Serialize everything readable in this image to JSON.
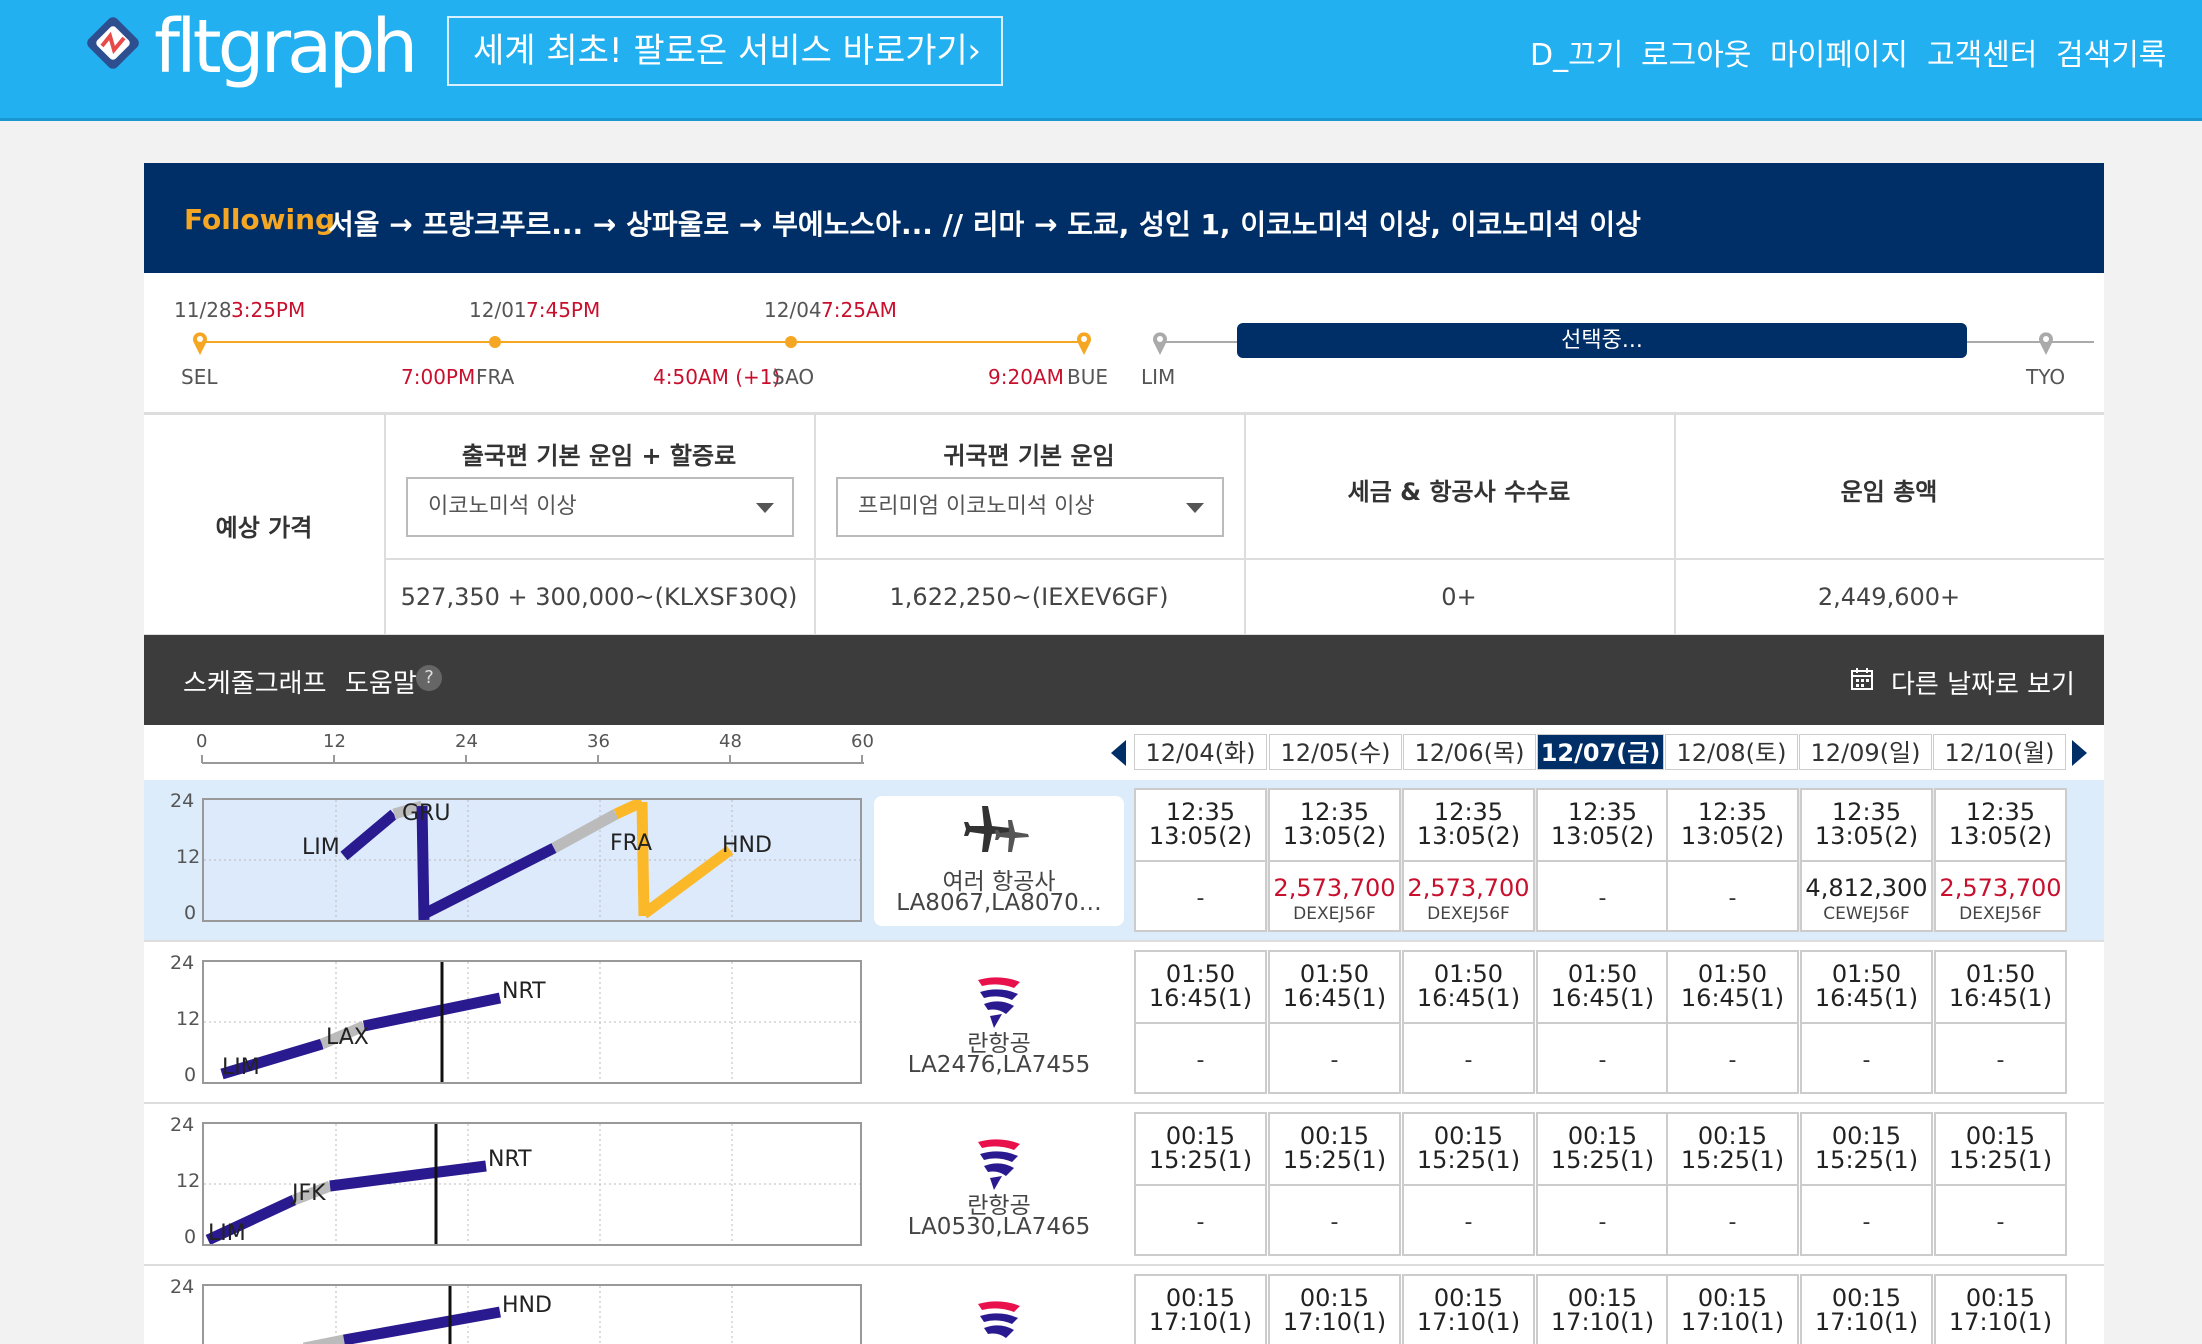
{
  "header": {
    "logo": "fltgraph",
    "promo": "세계 최초! 팔로온 서비스 바로가기",
    "nav": [
      "D_끄기",
      "로그아웃",
      "마이페이지",
      "고객센터",
      "검색기록"
    ]
  },
  "trip": {
    "following": "Following",
    "route": "서울 → 프랑크푸르... → 상파울로 → 부에노스아... // 리마 → 도쿄, 성인 1, 이코노미석 이상, 이코노미석 이상"
  },
  "timeline": {
    "points": [
      {
        "date": "11/28",
        "time": "3:25PM",
        "code": "SEL"
      },
      {
        "date": "12/01",
        "time": "7:45PM",
        "code": "FRA",
        "arrive": "7:00PM"
      },
      {
        "date": "12/04",
        "time": "7:25AM",
        "code": "SAO",
        "arrive": "4:50AM (+1)"
      },
      {
        "code": "BUE",
        "arrive": "9:20AM"
      },
      {
        "code": "LIM"
      },
      {
        "code": "TYO"
      }
    ],
    "selecting": "선택중..."
  },
  "prices": {
    "label": "예상 가격",
    "outbound_header": "출국편 기본 운임 + 할증료",
    "outbound_select": "이코노미석 이상",
    "outbound_value": "527,350 + 300,000~(KLXSF30Q)",
    "return_header": "귀국편 기본 운임",
    "return_select": "프리미엄 이코노미석 이상",
    "return_value": "1,622,250~(IEXEV6GF)",
    "tax_header": "세금 & 항공사 수수료",
    "tax_value": "0+",
    "total_header": "운임 총액",
    "total_value": "2,449,600+"
  },
  "graph_bar": {
    "title": "스케줄그래프",
    "help": "도움말",
    "help_q": "?",
    "other_dates": "다른 날짜로 보기"
  },
  "axis": [
    "0",
    "12",
    "24",
    "36",
    "48",
    "60"
  ],
  "dates": [
    "12/04(화)",
    "12/05(수)",
    "12/06(목)",
    "12/07(금)",
    "12/08(토)",
    "12/09(일)",
    "12/10(월)"
  ],
  "active_date": "12/07(금)",
  "y_labels": [
    "24",
    "12",
    "0"
  ],
  "rows": [
    {
      "airline": "여러 항공사",
      "flights": "LA8067,LA8070…",
      "stops": [
        "LIM",
        "GRU",
        "FRA",
        "HND"
      ],
      "time": "12:35\n13:05(2)",
      "cells": [
        {
          "price": "-"
        },
        {
          "price": "2,573,700",
          "code": "DEXEJ56F",
          "red": true
        },
        {
          "price": "2,573,700",
          "code": "DEXEJ56F",
          "red": true
        },
        {
          "price": "-"
        },
        {
          "price": "-"
        },
        {
          "price": "4,812,300",
          "code": "CEWEJ56F",
          "red": false
        },
        {
          "price": "2,573,700",
          "code": "DEXEJ56F",
          "red": true
        }
      ]
    },
    {
      "airline": "란항공",
      "flights": "LA2476,LA7455",
      "stops": [
        "LIM",
        "LAX",
        "NRT"
      ],
      "time": "01:50\n16:45(1)",
      "cells": [
        {
          "price": "-"
        },
        {
          "price": "-"
        },
        {
          "price": "-"
        },
        {
          "price": "-"
        },
        {
          "price": "-"
        },
        {
          "price": "-"
        },
        {
          "price": "-"
        }
      ]
    },
    {
      "airline": "란항공",
      "flights": "LA0530,LA7465",
      "stops": [
        "LIM",
        "JFK",
        "NRT"
      ],
      "time": "00:15\n15:25(1)",
      "cells": [
        {
          "price": "-"
        },
        {
          "price": "-"
        },
        {
          "price": "-"
        },
        {
          "price": "-"
        },
        {
          "price": "-"
        },
        {
          "price": "-"
        },
        {
          "price": "-"
        }
      ]
    },
    {
      "airline": "",
      "flights": "",
      "stops": [
        "HND"
      ],
      "time": "00:15\n17:10(1)",
      "cells": []
    }
  ],
  "colors": {
    "brand": "#22b0f0",
    "navy": "#002e66",
    "route": "#2a1a8f",
    "yellow": "#fbb829",
    "price_red": "#c8102e",
    "accent_orange": "#f5a623"
  }
}
